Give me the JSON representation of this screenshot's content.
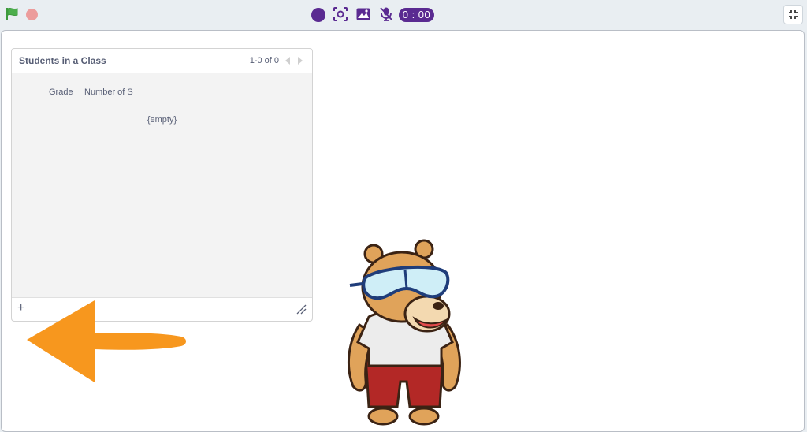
{
  "toolbar": {
    "timer": "0 : 00",
    "icons": [
      "green-flag-icon",
      "stop-icon",
      "record-icon",
      "screenshot-icon",
      "image-icon",
      "microphone-icon",
      "fullscreen-exit-icon"
    ],
    "accent_color": "#5a2a91"
  },
  "list_monitor": {
    "title": "Students in a Class",
    "count": "1-0 of 0",
    "columns": [
      "Grade",
      "Number of S"
    ],
    "empty_text": "{empty}",
    "add_label": "+"
  },
  "annotation": {
    "arrow_color": "#f7971e"
  },
  "sprite": {
    "name": "bear"
  }
}
